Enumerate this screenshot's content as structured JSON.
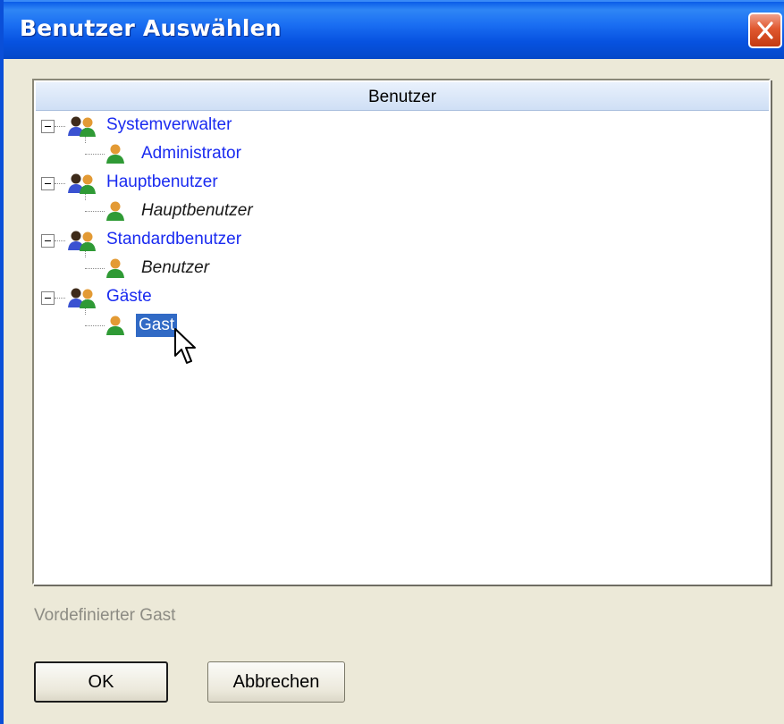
{
  "window": {
    "title": "Benutzer Auswählen"
  },
  "tree": {
    "column_header": "Benutzer",
    "groups": [
      {
        "label": "Systemverwalter",
        "children": [
          {
            "label": "Administrator",
            "italic": false,
            "selected": false
          }
        ]
      },
      {
        "label": "Hauptbenutzer",
        "children": [
          {
            "label": "Hauptbenutzer",
            "italic": true,
            "selected": false
          }
        ]
      },
      {
        "label": "Standardbenutzer",
        "children": [
          {
            "label": "Benutzer",
            "italic": true,
            "selected": false
          }
        ]
      },
      {
        "label": "Gäste",
        "children": [
          {
            "label": "Gast",
            "italic": false,
            "selected": true
          }
        ]
      }
    ]
  },
  "description": "Vordefinierter Gast",
  "buttons": {
    "ok_label": "OK",
    "cancel_label": "Abbrechen"
  },
  "colors": {
    "titlebar": "#0a5ce8",
    "link_text": "#1a2bf0",
    "selection": "#316ac5",
    "dialog_bg": "#ece9d8"
  }
}
